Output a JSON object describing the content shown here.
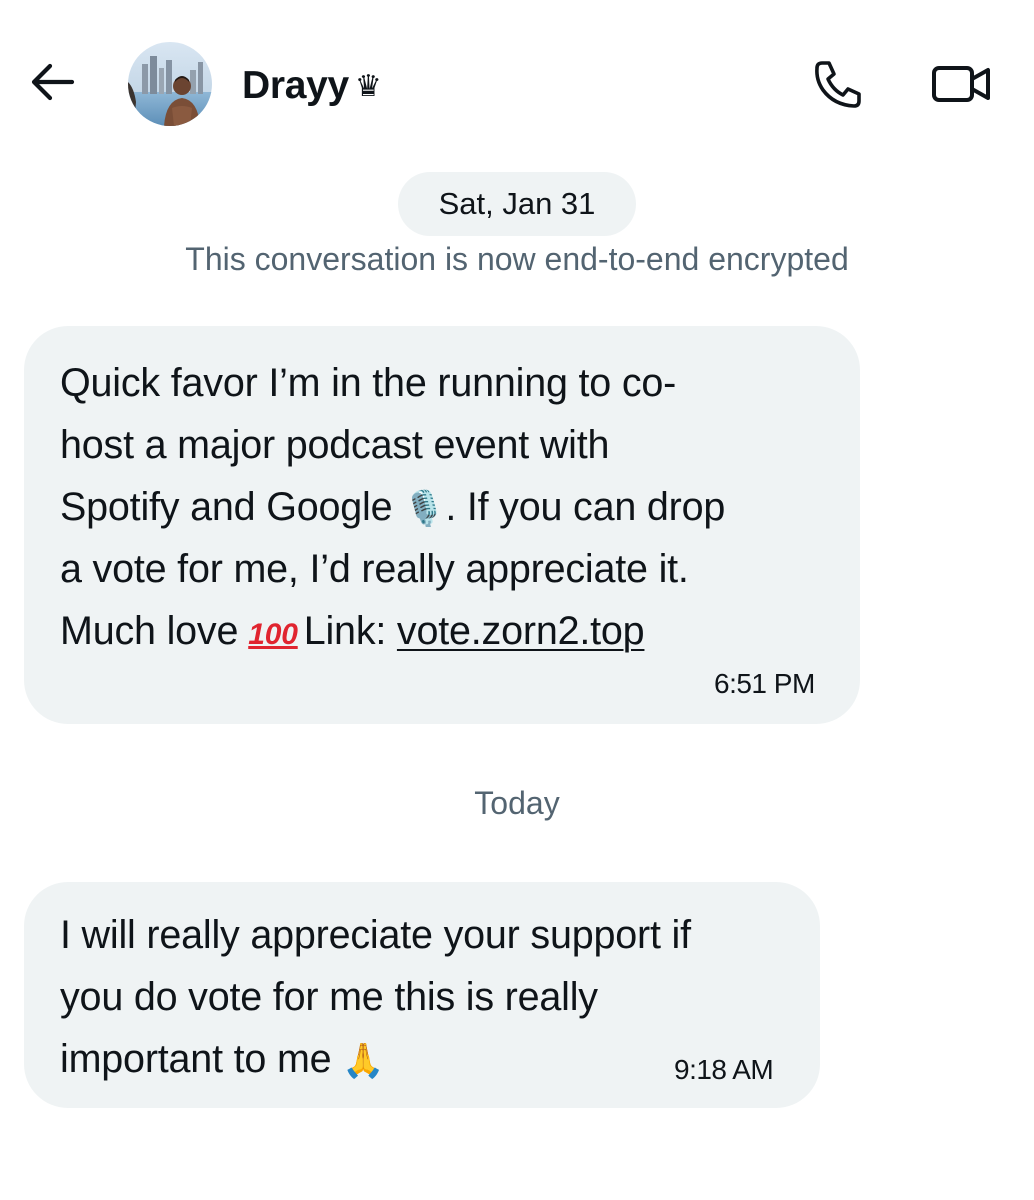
{
  "header": {
    "contact_name": "Drayy",
    "name_badge": "♛",
    "icons": {
      "back": "arrow-left-icon",
      "call": "phone-icon",
      "video": "video-camera-icon"
    }
  },
  "conversation": {
    "date_chip": "Sat, Jan 31",
    "encryption_notice": "This conversation is now end-to-end encrypted",
    "messages": [
      {
        "lines": [
          "Quick favor I’m in the running to co-",
          "host a major podcast event with",
          "Spotify and Google",
          ". If you can drop",
          "a vote for me, I’d really appreciate it.",
          "Much love",
          "Link:"
        ],
        "emoji_microphone": "🎙️",
        "emoji_hundred": "100",
        "link_text": "vote.zorn2.top",
        "time": "6:51 PM"
      },
      {
        "lines": [
          "I will really appreciate your support if",
          "you do vote for me this is really",
          "important to me"
        ],
        "emoji_pray": "🙏",
        "time": "9:18 AM"
      }
    ],
    "day_separator": "Today"
  },
  "colors": {
    "bubble_bg": "#eff3f4",
    "muted_text": "#536471",
    "primary_text": "#0f1419",
    "hundred_red": "#e0242f"
  }
}
